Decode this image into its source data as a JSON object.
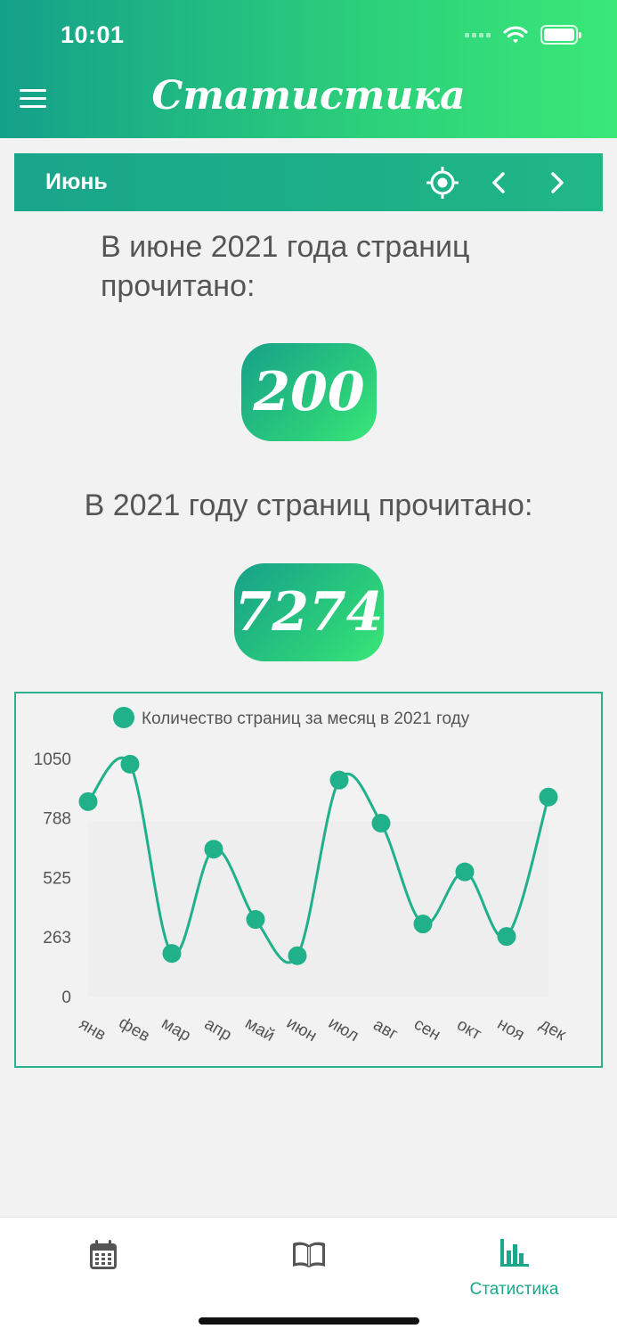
{
  "status_bar": {
    "time": "10:01"
  },
  "header": {
    "title": "Статистика"
  },
  "month_bar": {
    "label": "Июнь"
  },
  "month_stats": {
    "text": "В июне 2021 года страниц прочитано:",
    "value": "200"
  },
  "year_stats": {
    "text": "В 2021 году страниц прочитано:",
    "value": "7274"
  },
  "chart_data": {
    "type": "line",
    "legend": "Количество страниц за месяц в 2021 году",
    "categories": [
      "янв",
      "фев",
      "мар",
      "апр",
      "май",
      "июн",
      "июл",
      "авг",
      "сен",
      "окт",
      "ноя",
      "дек"
    ],
    "values": [
      860,
      1025,
      190,
      650,
      340,
      180,
      955,
      765,
      320,
      550,
      265,
      880
    ],
    "yticks": [
      "1050",
      "788",
      "525",
      "263",
      "0"
    ],
    "ylim": [
      0,
      1050
    ],
    "series_color": "#20b08a",
    "legend_placement": "top-center"
  },
  "tabbar": {
    "stats_label": "Статистика",
    "active_color": "#1aa88a",
    "inactive_color": "#555555"
  }
}
